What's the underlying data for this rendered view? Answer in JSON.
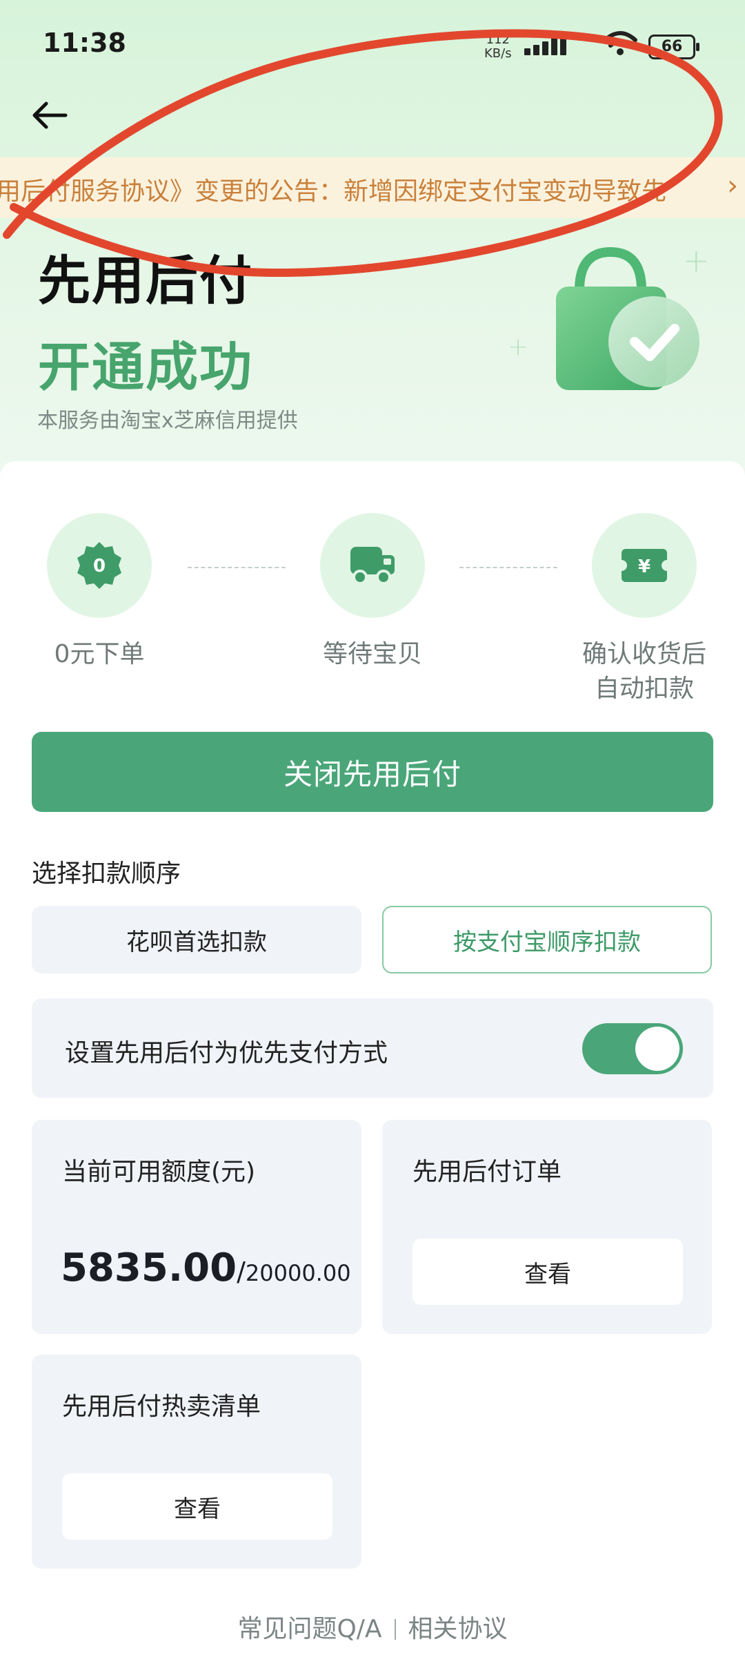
{
  "status_bar": {
    "time": "11:38",
    "network_speed_value": "112",
    "network_speed_unit": "KB/s",
    "battery": "66"
  },
  "notice": {
    "text": "用后付服务协议》变更的公告：新增因绑定支付宝变动导致先"
  },
  "hero": {
    "title_line1": "先用后付",
    "title_line2": "开通成功",
    "provider": "本服务由淘宝x芝麻信用提供"
  },
  "steps": [
    {
      "label": "0元下单",
      "icon": "zero-badge-icon",
      "badge": "0"
    },
    {
      "label": "等待宝贝",
      "icon": "truck-icon"
    },
    {
      "label_line1": "确认收货后",
      "label_line2": "自动扣款",
      "icon": "yen-ticket-icon"
    }
  ],
  "close_button": "关闭先用后付",
  "deduction": {
    "title": "选择扣款顺序",
    "options": [
      "花呗首选扣款",
      "按支付宝顺序扣款"
    ],
    "selected": "按支付宝顺序扣款"
  },
  "preference": {
    "label": "设置先用后付为优先支付方式",
    "toggle_on": true
  },
  "credit": {
    "title": "当前可用额度(元)",
    "available": "5835.00",
    "slash": "/",
    "total": "20000.00"
  },
  "orders": {
    "title": "先用后付订单",
    "button": "查看"
  },
  "hot_list": {
    "title": "先用后付热卖清单",
    "button": "查看"
  },
  "footer": {
    "faq": "常见问题Q/A",
    "agreements": "相关协议"
  },
  "colors": {
    "brand_green": "#4aa679",
    "title_green": "#47a46c",
    "notice_text": "#c9803a",
    "annotation_red": "#e2472e"
  }
}
